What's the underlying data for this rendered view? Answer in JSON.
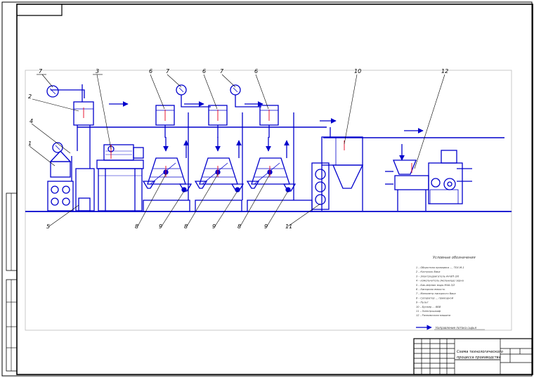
{
  "drawing": {
    "line_color": "#0000cc",
    "accent_color": "#e8001c",
    "frame_color": "#000000",
    "stamp_code": "",
    "labels": [
      "7",
      "2",
      "3",
      "6",
      "7",
      "6",
      "7",
      "6",
      "10",
      "12",
      "4",
      "1",
      "5",
      "8",
      "9",
      "8",
      "9",
      "8",
      "9",
      "11"
    ],
    "legend": {
      "title": "Условные обозначения",
      "items": [
        "1 – Оборотная промывка ..., ТЕХ-М-1",
        "2 – Контроль бака",
        "3 – Электродвигатель А4-ВП-3/0",
        "4 – измельчитель (мельница) зерна",
        "5 – Бак-мерник воды М4А-3/2",
        "6 – Напорная емкость",
        "7 – Манометр напорного бака",
        "8 – Сепаратор ... приводной",
        "9 – Пульт",
        "10 – Бункер ... ВБВ",
        "11 – Электрошкаф",
        "12 – Разливочная машина"
      ],
      "flow_label": "Направление потока сырья"
    },
    "title_block": {
      "title_line1": "Схема технологического",
      "title_line2": "процесса производства"
    }
  }
}
